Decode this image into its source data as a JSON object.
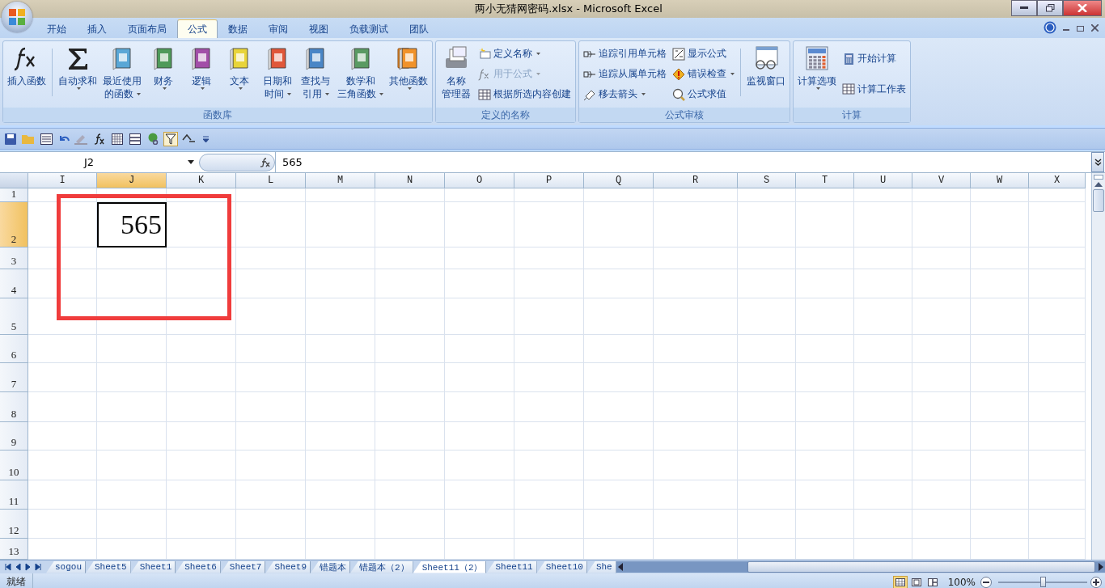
{
  "window": {
    "title": "两小无猜网密码.xlsx - Microsoft Excel"
  },
  "tabs": [
    {
      "label": "开始",
      "selected": false
    },
    {
      "label": "插入",
      "selected": false
    },
    {
      "label": "页面布局",
      "selected": false
    },
    {
      "label": "公式",
      "selected": true
    },
    {
      "label": "数据",
      "selected": false
    },
    {
      "label": "审阅",
      "selected": false
    },
    {
      "label": "视图",
      "selected": false
    },
    {
      "label": "负载测试",
      "selected": false
    },
    {
      "label": "团队",
      "selected": false
    }
  ],
  "ribbon": [
    {
      "label": "函数库",
      "items": [
        {
          "kind": "large",
          "lines": [
            "插入函数"
          ],
          "dropdown": false
        },
        {
          "kind": "separator"
        },
        {
          "kind": "large",
          "lines": [
            "自动求和"
          ],
          "dropdown": true
        },
        {
          "kind": "large",
          "lines": [
            "最近使用",
            "的函数"
          ],
          "dropdown": true
        },
        {
          "kind": "large",
          "lines": [
            "财务"
          ],
          "dropdown": true
        },
        {
          "kind": "large",
          "lines": [
            "逻辑"
          ],
          "dropdown": true
        },
        {
          "kind": "large",
          "lines": [
            "文本"
          ],
          "dropdown": true
        },
        {
          "kind": "large",
          "lines": [
            "日期和",
            "时间"
          ],
          "dropdown": true
        },
        {
          "kind": "large",
          "lines": [
            "查找与",
            "引用"
          ],
          "dropdown": true
        },
        {
          "kind": "large",
          "lines": [
            "数学和",
            "三角函数"
          ],
          "dropdown": true
        },
        {
          "kind": "large",
          "lines": [
            "其他函数"
          ],
          "dropdown": true
        }
      ]
    },
    {
      "label": "定义的名称",
      "items": [
        {
          "kind": "large",
          "lines": [
            "名称",
            "管理器"
          ],
          "dropdown": false
        },
        {
          "kind": "stack",
          "items": [
            {
              "label": "定义名称",
              "dropdown": true,
              "disabled": false
            },
            {
              "label": "用于公式",
              "dropdown": true,
              "disabled": true
            },
            {
              "label": "根据所选内容创建",
              "dropdown": false,
              "disabled": false
            }
          ]
        }
      ]
    },
    {
      "label": "公式审核",
      "items": [
        {
          "kind": "stack",
          "items": [
            {
              "label": "追踪引用单元格",
              "dropdown": false,
              "disabled": false
            },
            {
              "label": "追踪从属单元格",
              "dropdown": false,
              "disabled": false
            },
            {
              "label": "移去箭头",
              "dropdown": true,
              "disabled": false
            }
          ]
        },
        {
          "kind": "stack",
          "items": [
            {
              "label": "显示公式",
              "dropdown": false,
              "disabled": false
            },
            {
              "label": "错误检查",
              "dropdown": true,
              "disabled": false
            },
            {
              "label": "公式求值",
              "dropdown": false,
              "disabled": false
            }
          ]
        },
        {
          "kind": "separator"
        },
        {
          "kind": "large",
          "lines": [
            "监视窗口"
          ],
          "dropdown": false
        }
      ]
    },
    {
      "label": "计算",
      "items": [
        {
          "kind": "large",
          "lines": [
            "计算选项"
          ],
          "dropdown": true
        },
        {
          "kind": "stack",
          "items": [
            {
              "label": "开始计算",
              "dropdown": false,
              "disabled": false
            },
            {
              "label": "计算工作表",
              "dropdown": false,
              "disabled": false
            }
          ]
        }
      ]
    }
  ],
  "name_box": {
    "value": "J2"
  },
  "formula_bar": {
    "value": "565"
  },
  "columns": [
    {
      "label": "I",
      "selected": false
    },
    {
      "label": "J",
      "selected": true
    },
    {
      "label": "K",
      "selected": false
    },
    {
      "label": "L",
      "selected": false
    },
    {
      "label": "M",
      "selected": false
    },
    {
      "label": "N",
      "selected": false
    },
    {
      "label": "O",
      "selected": false
    },
    {
      "label": "P",
      "selected": false
    },
    {
      "label": "Q",
      "selected": false
    },
    {
      "label": "R",
      "selected": false
    },
    {
      "label": "S",
      "selected": false
    },
    {
      "label": "T",
      "selected": false
    },
    {
      "label": "U",
      "selected": false
    },
    {
      "label": "V",
      "selected": false
    },
    {
      "label": "W",
      "selected": false
    },
    {
      "label": "X",
      "selected": false
    }
  ],
  "rows": [
    {
      "label": "1",
      "selected": false
    },
    {
      "label": "2",
      "selected": true
    },
    {
      "label": "3",
      "selected": false
    },
    {
      "label": "4",
      "selected": false
    },
    {
      "label": "5",
      "selected": false
    },
    {
      "label": "6",
      "selected": false
    },
    {
      "label": "7",
      "selected": false
    },
    {
      "label": "8",
      "selected": false
    },
    {
      "label": "9",
      "selected": false
    },
    {
      "label": "10",
      "selected": false
    },
    {
      "label": "11",
      "selected": false
    },
    {
      "label": "12",
      "selected": false
    },
    {
      "label": "13",
      "selected": false
    }
  ],
  "active_cell": {
    "value": "565"
  },
  "annotation_frame": true,
  "sheet_tabs": [
    {
      "label": "sogou",
      "selected": false
    },
    {
      "label": "Sheet5",
      "selected": false
    },
    {
      "label": "Sheet1",
      "selected": false
    },
    {
      "label": "Sheet6",
      "selected": false
    },
    {
      "label": "Sheet7",
      "selected": false
    },
    {
      "label": "Sheet9",
      "selected": false
    },
    {
      "label": "错题本",
      "selected": false
    },
    {
      "label": "错题本（2）",
      "selected": false
    },
    {
      "label": "Sheet11（2）",
      "selected": true
    },
    {
      "label": "Sheet11",
      "selected": false
    },
    {
      "label": "Sheet10",
      "selected": false
    },
    {
      "label": "She",
      "selected": false
    }
  ],
  "status_bar": {
    "status": "就绪",
    "zoom": "100%",
    "zoom_level": {
      "level": 0.5
    },
    "views": [
      {
        "kind": "normal",
        "selected": true
      },
      {
        "kind": "page_layout",
        "selected": false
      },
      {
        "kind": "page_break",
        "selected": false
      }
    ]
  }
}
